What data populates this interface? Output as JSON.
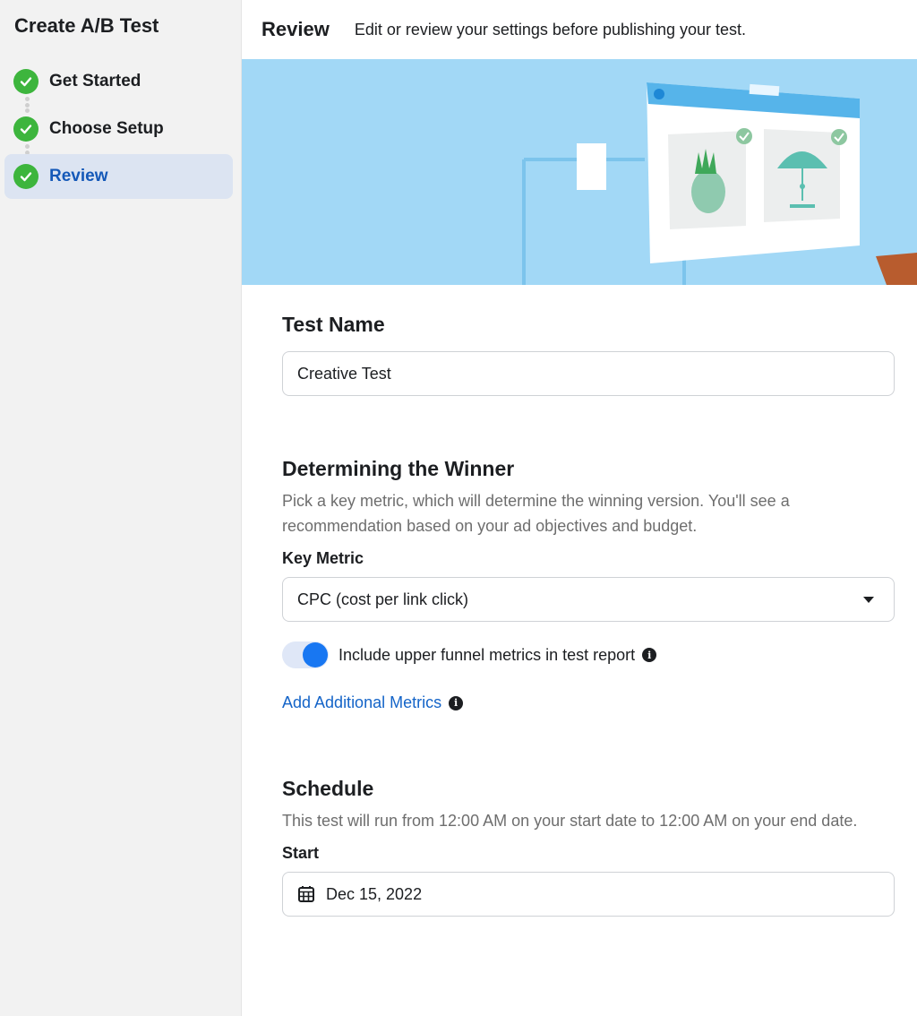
{
  "sidebar": {
    "title": "Create A/B Test",
    "steps": [
      {
        "label": "Get Started"
      },
      {
        "label": "Choose Setup"
      },
      {
        "label": "Review"
      }
    ]
  },
  "header": {
    "title": "Review",
    "subtitle": "Edit or review your settings before publishing your test."
  },
  "test_name": {
    "title": "Test Name",
    "value": "Creative Test"
  },
  "winner": {
    "title": "Determining the Winner",
    "description": "Pick a key metric, which will determine the winning version. You'll see a recommendation based on your ad objectives and budget.",
    "key_metric_label": "Key Metric",
    "key_metric_value": "CPC (cost per link click)",
    "toggle_label": "Include upper funnel metrics in test report",
    "toggle_on": true,
    "add_metrics_link": "Add Additional Metrics"
  },
  "schedule": {
    "title": "Schedule",
    "description": "This test will run from 12:00 AM on your start date to 12:00 AM on your end date.",
    "start_label": "Start",
    "start_value": "Dec 15, 2022"
  },
  "colors": {
    "accent": "#1877f2",
    "link": "#1464c8",
    "success": "#3db53d",
    "hero_bg": "#a2d8f6"
  },
  "icons": {
    "step_status": "check-circle-icon",
    "info": "info-icon",
    "dropdown": "caret-down-icon",
    "calendar": "calendar-icon"
  }
}
